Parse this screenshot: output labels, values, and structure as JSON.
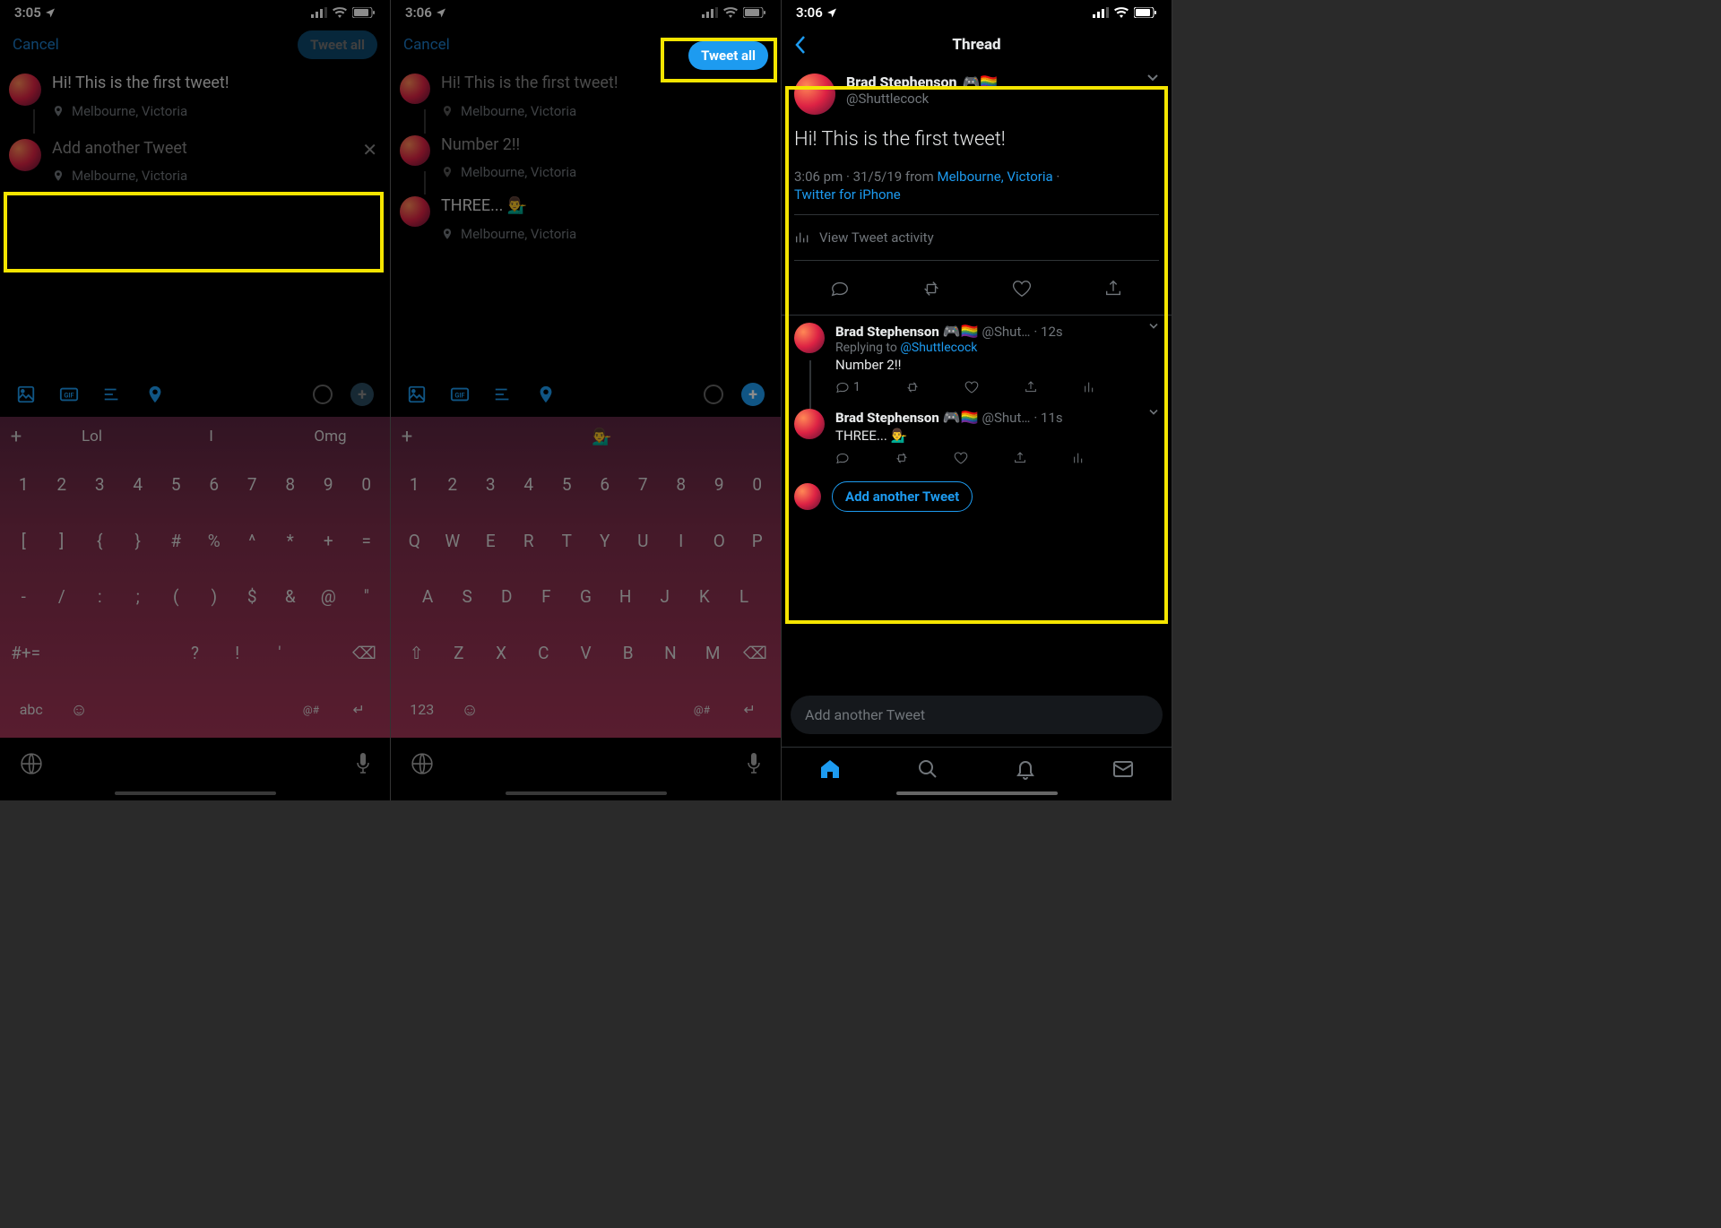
{
  "screen1": {
    "time": "3:05",
    "cancel": "Cancel",
    "tweet_all": "Tweet all",
    "tweet1": "Hi! This is the first tweet!",
    "loc": "Melbourne, Victoria",
    "placeholder": "Add another Tweet",
    "sugg": [
      "Lol",
      "I",
      "Omg"
    ],
    "keys_num": [
      "1",
      "2",
      "3",
      "4",
      "5",
      "6",
      "7",
      "8",
      "9",
      "0"
    ],
    "keys_sym1": [
      "[",
      "]",
      "{",
      "}",
      "#",
      "%",
      "^",
      "*",
      "+",
      "="
    ],
    "keys_sym2": [
      "-",
      "/",
      ":",
      ";",
      "(",
      ")",
      "$",
      "&",
      "@",
      "\""
    ],
    "keys_sym3": [
      "#+=",
      " ",
      " ",
      " ",
      "?",
      "!",
      "'",
      " ",
      "⌫"
    ],
    "abc": "abc"
  },
  "screen2": {
    "time": "3:06",
    "cancel": "Cancel",
    "tweet_all": "Tweet all",
    "tweet1": "Hi! This is the first tweet!",
    "tweet2": "Number 2!!",
    "tweet3": "THREE... 💁‍♂️",
    "loc": "Melbourne, Victoria",
    "sugg_emoji": "💁‍♂️",
    "keys_num": [
      "1",
      "2",
      "3",
      "4",
      "5",
      "6",
      "7",
      "8",
      "9",
      "0"
    ],
    "keys_q": [
      "Q",
      "W",
      "E",
      "R",
      "T",
      "Y",
      "U",
      "I",
      "O",
      "P"
    ],
    "keys_a": [
      "A",
      "S",
      "D",
      "F",
      "G",
      "H",
      "J",
      "K",
      "L"
    ],
    "keys_z": [
      "⇧",
      "Z",
      "X",
      "C",
      "V",
      "B",
      "N",
      "M",
      "⌫"
    ],
    "mode": "123"
  },
  "screen3": {
    "time": "3:06",
    "title": "Thread",
    "user_name": "Brad Stephenson",
    "user_handle": "@Shuttlecock",
    "badges": "🎮🏳️‍🌈",
    "main_text": "Hi! This is the first tweet!",
    "meta_time": "3:06 pm",
    "meta_date": "31/5/19",
    "meta_from": "from",
    "meta_loc": "Melbourne, Victoria",
    "meta_source": "Twitter for iPhone",
    "view_activity": "View Tweet activity",
    "reply1": {
      "handle_short": "@Shut…",
      "time": "12s",
      "replying": "Replying to",
      "replying_to": "@Shuttlecock",
      "body": "Number 2!!",
      "reply_count": "1"
    },
    "reply2": {
      "handle_short": "@Shut…",
      "time": "11s",
      "body": "THREE... 💁‍♂️"
    },
    "add_another": "Add another Tweet",
    "compose_placeholder": "Add another Tweet"
  }
}
